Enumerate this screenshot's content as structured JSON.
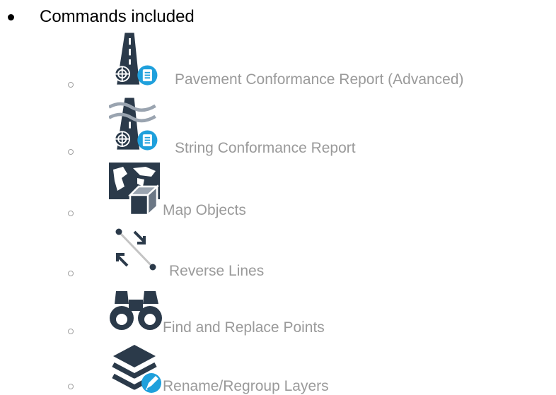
{
  "heading": {
    "text": "Commands included"
  },
  "commands": [
    {
      "label": "Pavement Conformance Report (Advanced)",
      "icon": "road-conformance-report-icon"
    },
    {
      "label": "String Conformance Report",
      "icon": "string-conformance-report-icon"
    },
    {
      "label": "Map Objects",
      "icon": "map-objects-icon"
    },
    {
      "label": "Reverse Lines",
      "icon": "reverse-lines-icon"
    },
    {
      "label": "Find and Replace Points",
      "icon": "binoculars-icon"
    },
    {
      "label": "Rename/Regroup Layers",
      "icon": "layers-edit-icon"
    }
  ],
  "colors": {
    "text_dark": "#000000",
    "text_muted": "#9a9a9a",
    "icon_dark": "#2b3a4a",
    "accent_blue": "#1fa0dc",
    "icon_gray": "#9aa4b0"
  }
}
